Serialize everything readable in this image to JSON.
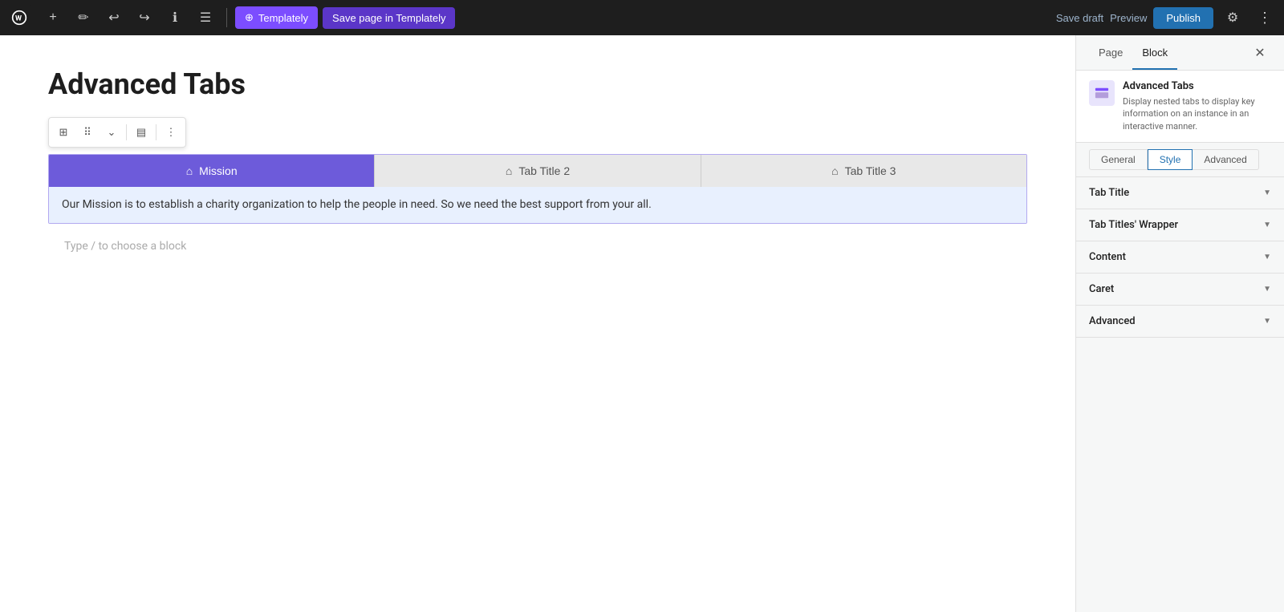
{
  "toolbar": {
    "add_label": "+",
    "pencil_label": "✏",
    "undo_label": "↩",
    "redo_label": "↪",
    "info_label": "ℹ",
    "list_label": "☰",
    "templately_label": "Templately",
    "save_templately_label": "Save page in Templately",
    "save_draft_label": "Save draft",
    "preview_label": "Preview",
    "publish_label": "Publish",
    "settings_label": "⚙",
    "more_label": "⋮"
  },
  "editor": {
    "page_title": "Advanced Tabs",
    "type_hint": "Type / to choose a block"
  },
  "block_toolbar": {
    "grid_icon": "⊞",
    "move_icon": "⠿",
    "chevron_icon": "⌄",
    "align_icon": "▤",
    "more_icon": "⋮"
  },
  "tabs": {
    "items": [
      {
        "label": "Mission",
        "active": true
      },
      {
        "label": "Tab Title 2",
        "active": false
      },
      {
        "label": "Tab Title 3",
        "active": false
      }
    ],
    "content": "Our Mission is to establish a charity organization to help the people in need. So we need the best support from your all."
  },
  "right_panel": {
    "tab_page": "Page",
    "tab_block": "Block",
    "block_title": "Advanced Tabs",
    "block_description": "Display nested tabs to display key information on an instance in an interactive manner.",
    "style_tabs": [
      "General",
      "Style",
      "Advanced"
    ],
    "active_style_tab": "Style",
    "accordion_sections": [
      {
        "label": "Tab Title"
      },
      {
        "label": "Tab Titles' Wrapper"
      },
      {
        "label": "Content"
      },
      {
        "label": "Caret"
      },
      {
        "label": "Advanced"
      }
    ]
  }
}
